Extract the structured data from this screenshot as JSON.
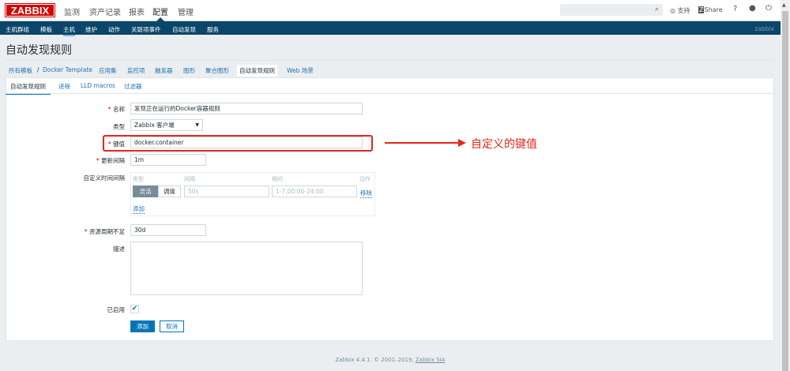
{
  "header": {
    "logo": "ZABBIX",
    "main_menu": [
      "监测",
      "资产记录",
      "报表",
      "配置",
      "管理"
    ],
    "active_main": "配置",
    "search_placeholder": "",
    "support": "支持",
    "share": "Share",
    "help": "?",
    "user_icon": "user-icon",
    "logout_icon": "power-icon"
  },
  "subnav": {
    "items": [
      "主机群组",
      "模板",
      "主机",
      "维护",
      "动作",
      "关联项事件",
      "自动发现",
      "服务"
    ],
    "active": "主机",
    "user": "zabbix"
  },
  "page": {
    "title": "自动发现规则"
  },
  "breadcrumbs": {
    "root": "所有模板",
    "template": "Docker Template",
    "items": [
      "应用集",
      "监控项",
      "触发器",
      "图形",
      "聚合图形",
      "自动发现规则",
      "Web 场景"
    ],
    "selected": "自动发现规则"
  },
  "tabs": [
    "自动发现规则",
    "进程",
    "LLD macros",
    "过滤器"
  ],
  "form": {
    "name_label": "名称",
    "name_value": "发现正在运行的Docker容器规则",
    "type_label": "类型",
    "type_value": "Zabbix 客户端",
    "key_label": "键值",
    "key_value": "docker.container",
    "interval_label": "更新间隔",
    "interval_value": "1m",
    "custom_label": "自定义时间间隔",
    "custom": {
      "col_type": "类型",
      "col_interval": "间隔",
      "col_period": "期间",
      "col_action": "动作",
      "flexible": "灵活",
      "scheduling": "调度",
      "interval_placeholder": "50s",
      "period_placeholder": "1-7,00:00-24:00",
      "remove": "移除",
      "add": "添加"
    },
    "lifetime_label": "资源周期不足",
    "lifetime_value": "30d",
    "desc_label": "描述",
    "desc_value": "",
    "enabled_label": "已启用",
    "enabled": true,
    "add_button": "添加",
    "cancel_button": "取消"
  },
  "annotation": {
    "text": "自定义的键值",
    "color": "#e8241c"
  },
  "footer": {
    "text": "Zabbix 4.4.1. © 2001–2019, ",
    "company": "Zabbix SIA"
  }
}
